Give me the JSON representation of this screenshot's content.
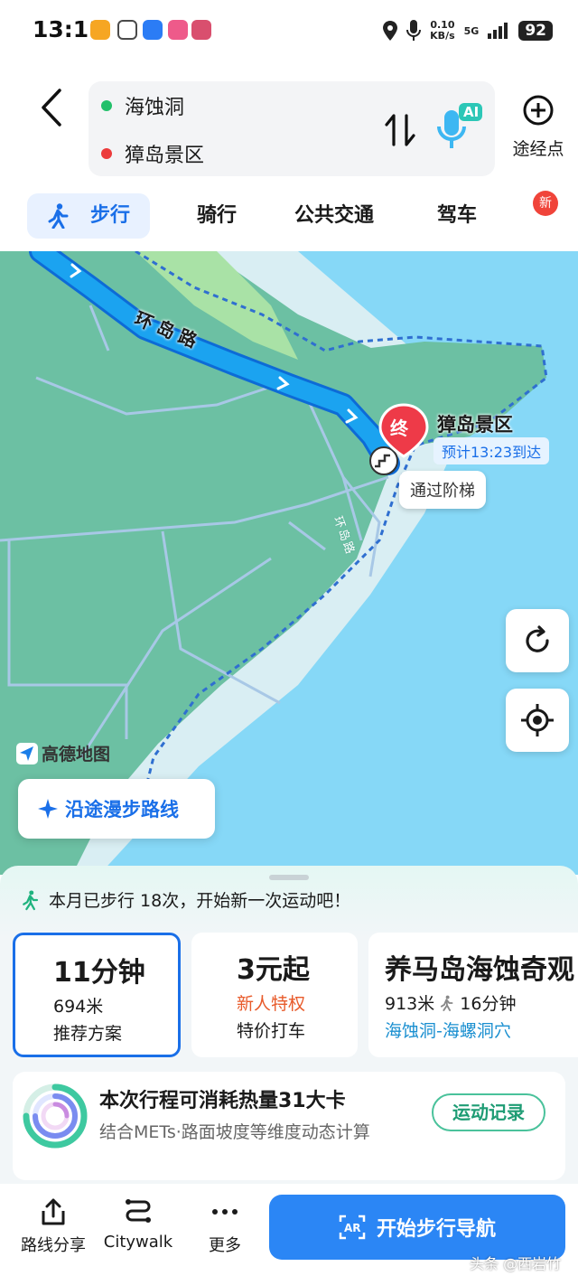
{
  "status_bar": {
    "time": "13:11",
    "net_speed_value": "0.10",
    "net_speed_unit": "KB/s",
    "network": "5G",
    "battery": "92",
    "app_icon_colors": [
      "#f6a623",
      "#4a4a4a",
      "#2b7cf5",
      "#ee5a8a",
      "#d94f6e"
    ]
  },
  "route": {
    "origin": "海蚀洞",
    "destination": "獐岛景区",
    "origin_color": "#22c06a",
    "destination_color": "#ec3b3b",
    "ai_label": "AI",
    "waypoint_label": "途经点"
  },
  "modes": {
    "walk": "步行",
    "bike": "骑行",
    "transit": "公共交通",
    "drive": "驾车",
    "new_badge": "新",
    "active": "walk"
  },
  "map": {
    "road_label_main": "环岛路",
    "road_label_side": "环岛路",
    "destination_marker": "终",
    "destination_name": "獐岛景区",
    "eta": "预计13:23到达",
    "stairs_tip": "通过阶梯",
    "logo_text": "高德地图",
    "stroll_button": "沿途漫步路线",
    "land_color": "#6cc0a3",
    "water_color": "#86d8f7",
    "route_color": "#1ba3f0"
  },
  "sheet": {
    "walk_stat": "本月已步行 18次，开始新一次运动吧！",
    "cards": [
      {
        "title": "11分钟",
        "line1": "694米",
        "line2": "推荐方案"
      },
      {
        "title": "3元起",
        "line1": "新人特权",
        "line2": "特价打车"
      },
      {
        "title": "养马岛海蚀奇观",
        "line1_distance": "913米",
        "line1_time": "16分钟",
        "line2": "海蚀洞-海螺洞穴"
      }
    ],
    "calorie_title": "本次行程可消耗热量31大卡",
    "calorie_sub": "结合METs·路面坡度等维度动态计算",
    "record_button": "运动记录"
  },
  "toolbar": {
    "share": "路线分享",
    "citywalk": "Citywalk",
    "more": "更多",
    "start_nav": "开始步行导航"
  },
  "watermark": "头条 @西岩竹"
}
